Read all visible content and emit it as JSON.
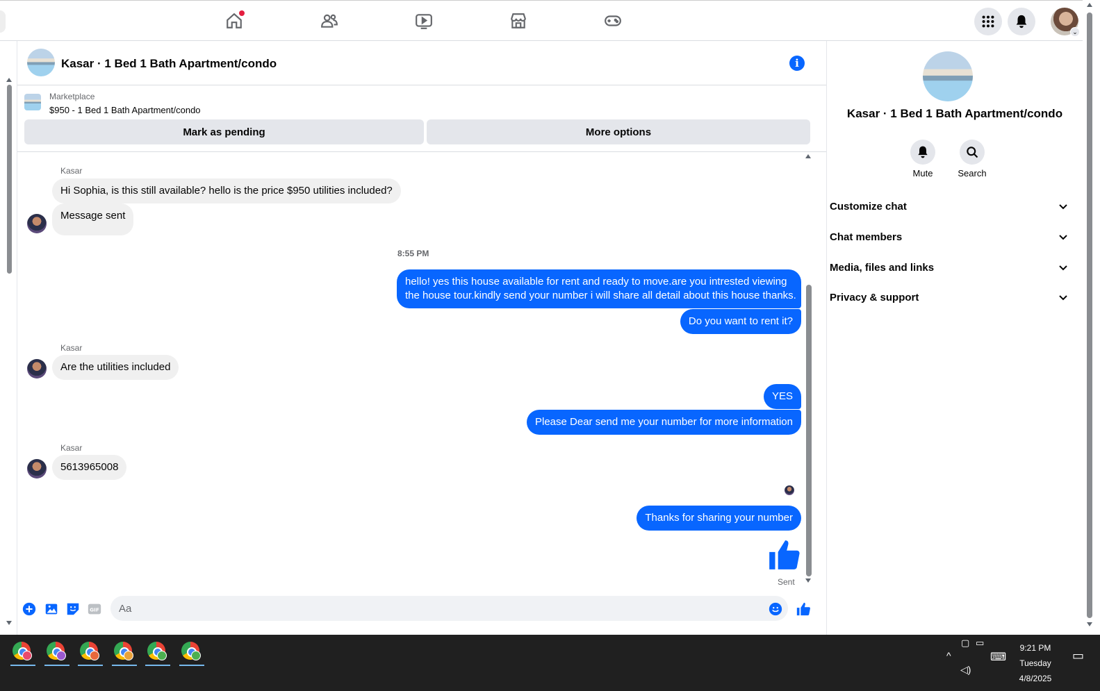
{
  "chat": {
    "title": "Kasar · 1 Bed 1 Bath Apartment/condo",
    "marketplace_label": "Marketplace",
    "listing": "$950 - 1 Bed 1 Bath Apartment/condo",
    "mark_pending": "Mark as pending",
    "more_options": "More options"
  },
  "messages": [
    {
      "id": "m1",
      "side": "in",
      "sender": "Kasar",
      "text": "Hi Sophia, is this still available? hello is the price $950 utilities included?"
    },
    {
      "id": "m2",
      "side": "in",
      "sender": "",
      "text": "Message sent"
    },
    {
      "id": "ts",
      "timestamp": "8:55 PM"
    },
    {
      "id": "m3",
      "side": "out",
      "line1": "hello! yes this house available for rent and ready to move.are you intrested viewing",
      "line2": "the house tour.kindly send your number i will share all detail about this house thanks."
    },
    {
      "id": "m4",
      "side": "out",
      "text": "Do you want to rent it?"
    },
    {
      "id": "m5",
      "side": "in",
      "sender": "Kasar",
      "text": "Are the utilities included"
    },
    {
      "id": "m6",
      "side": "out",
      "text": "YES"
    },
    {
      "id": "m7",
      "side": "out",
      "text": "Please Dear send me your number for more information"
    },
    {
      "id": "m8",
      "side": "in",
      "sender": "Kasar",
      "text": "5613965008"
    },
    {
      "id": "m9",
      "side": "out",
      "text": "Thanks for sharing your number"
    }
  ],
  "sent_status": "Sent",
  "composer": {
    "placeholder": "Aa"
  },
  "right_panel": {
    "title": "Kasar · 1 Bed 1 Bath Apartment/condo",
    "mute": "Mute",
    "search": "Search",
    "sections": [
      "Customize chat",
      "Chat members",
      "Media, files and links",
      "Privacy & support"
    ]
  },
  "taskbar": {
    "time": "9:21 PM",
    "day": "Tuesday",
    "date": "4/8/2025",
    "apps": [
      "chrome-profile-1",
      "chrome-profile-2",
      "chrome-profile-3",
      "chrome-profile-4",
      "chrome-profile-5",
      "chrome-profile-6"
    ],
    "badge_colors": [
      "#e94a6c",
      "#9b59d0",
      "#e8683c",
      "#e9a23b",
      "#4caf50",
      "#4caf50"
    ]
  },
  "colors": {
    "accent": "#0866ff",
    "notify": "#e41e3f"
  }
}
